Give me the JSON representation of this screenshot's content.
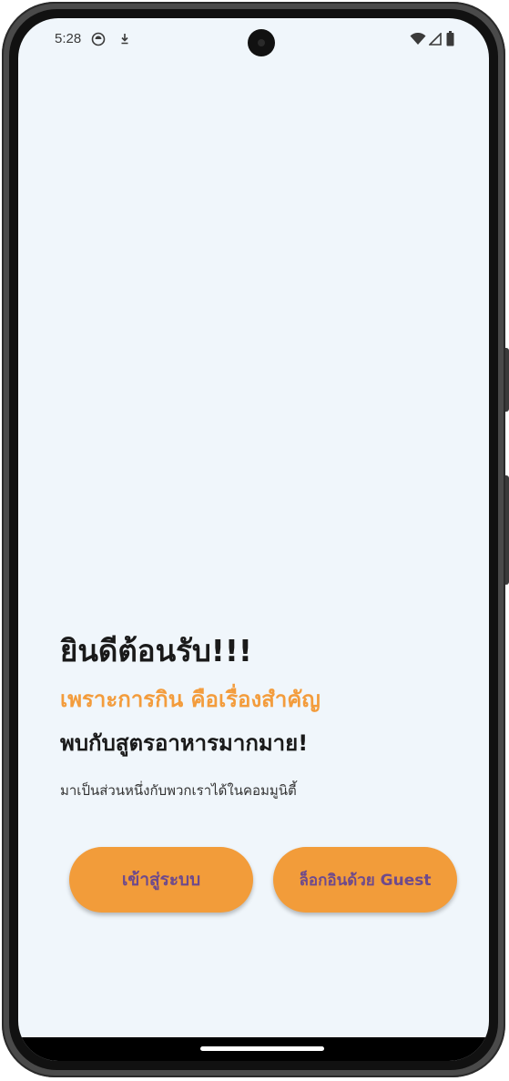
{
  "status_bar": {
    "time": "5:28"
  },
  "welcome": {
    "title": "ยินดีต้อนรับ!!!",
    "tagline": "เพราะการกิน คือเรื่องสำคัญ",
    "subtitle": "พบกับสูตรอาหารมากมาย!",
    "description": "มาเป็นส่วนหนึ่งกับพวกเราได้ในคอมมูนิตี้"
  },
  "buttons": {
    "login_label": "เข้าสู่ระบบ",
    "guest_label": "ล็อกอินด้วย Guest"
  },
  "colors": {
    "background": "#f0f6fb",
    "accent": "#f29c3a",
    "button_text": "#6e4a8c",
    "tagline": "#f39c3c"
  }
}
